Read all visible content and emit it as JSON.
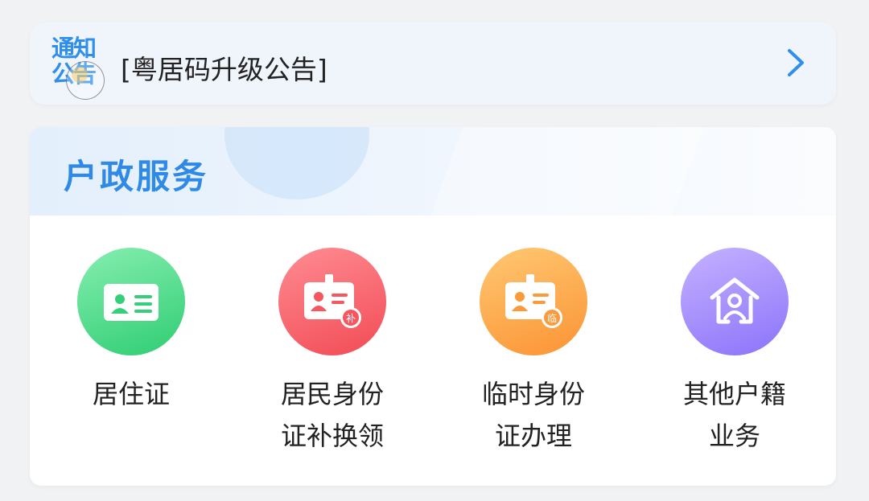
{
  "notice": {
    "logo_line1": "通知",
    "logo_line2": "公告",
    "text": "[粤居码升级公告]"
  },
  "section": {
    "title": "户政服务"
  },
  "services": [
    {
      "line1": "居住证",
      "line2": "",
      "icon": "residence-card-icon",
      "color": "#3dd37f"
    },
    {
      "line1": "居民身份",
      "line2": "证补换领",
      "icon": "id-card-reissue-icon",
      "badge": "补",
      "color": "#f65a62"
    },
    {
      "line1": "临时身份",
      "line2": "证办理",
      "icon": "temporary-id-icon",
      "badge": "临",
      "color": "#fc9c3c"
    },
    {
      "line1": "其他户籍",
      "line2": "业务",
      "icon": "household-registration-icon",
      "color": "#957efa"
    }
  ]
}
